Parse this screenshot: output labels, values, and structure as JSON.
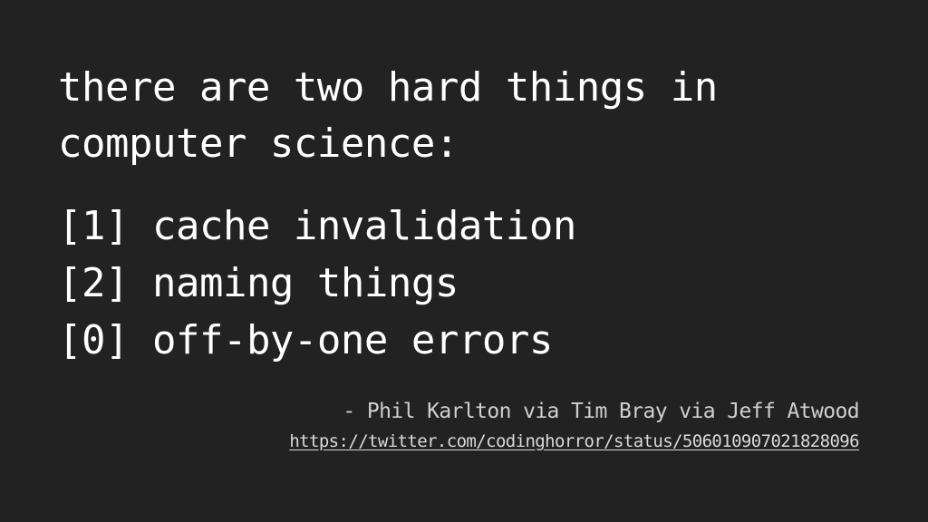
{
  "intro": {
    "line1": "there are two hard things in",
    "line2": "computer science:"
  },
  "items": [
    {
      "marker": "[1]",
      "text": "cache invalidation"
    },
    {
      "marker": "[2]",
      "text": "naming things"
    },
    {
      "marker": "[0]",
      "text": "off-by-one errors"
    }
  ],
  "attribution": "- Phil Karlton via Tim Bray via Jeff Atwood",
  "source_url": "https://twitter.com/codinghorror/status/506010907021828096",
  "colors": {
    "background": "#222222",
    "text": "#ffffff",
    "attribution": "#cfcfcf"
  }
}
